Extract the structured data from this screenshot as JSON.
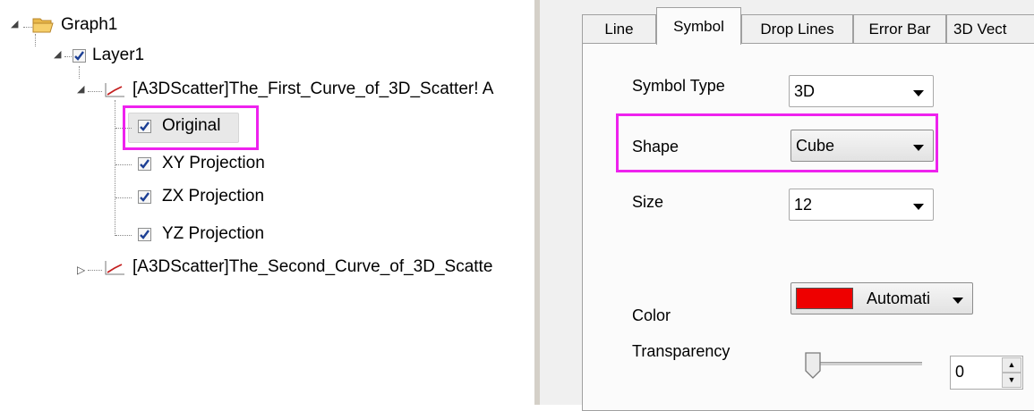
{
  "tree": {
    "graph": "Graph1",
    "layer": "Layer1",
    "curve1": "[A3DScatter]The_First_Curve_of_3D_Scatter! A",
    "items": [
      {
        "label": "Original",
        "checked": true
      },
      {
        "label": "XY Projection",
        "checked": true
      },
      {
        "label": "ZX Projection",
        "checked": true
      },
      {
        "label": "YZ Projection",
        "checked": true
      }
    ],
    "curve2": "[A3DScatter]The_Second_Curve_of_3D_Scatte"
  },
  "tabs": [
    "Line",
    "Symbol",
    "Drop Lines",
    "Error Bar",
    "3D Vect"
  ],
  "active_tab": "Symbol",
  "form": {
    "symbol_type_label": "Symbol Type",
    "symbol_type_value": "3D",
    "shape_label": "Shape",
    "shape_value": "Cube",
    "size_label": "Size",
    "size_value": "12",
    "color_label": "Color",
    "color_value": "Automati",
    "color_swatch": "#ee0000",
    "transparency_label": "Transparency",
    "transparency_value": "0"
  },
  "colors": {
    "highlight": "#ee22ee",
    "check": "#1c3f94",
    "curve_icon": "#c42020"
  }
}
